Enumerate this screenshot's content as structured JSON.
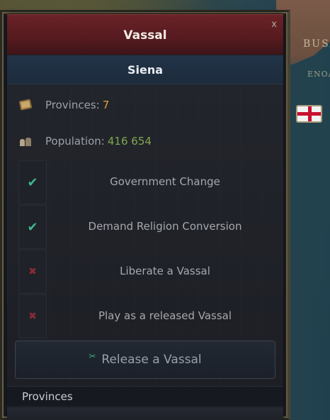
{
  "map": {
    "label_top": "BUSA",
    "label_bottom": "ENOA",
    "flag_icon": "england-flag-icon"
  },
  "window": {
    "title": "Vassal",
    "close_label": "x",
    "country_name": "Siena"
  },
  "stats": {
    "provinces_label": "Provinces:",
    "provinces_value": "7",
    "population_label": "Population:",
    "population_value": "416 654"
  },
  "options": [
    {
      "label": "Government Change",
      "allowed": true
    },
    {
      "label": "Demand Religion Conversion",
      "allowed": true
    },
    {
      "label": "Liberate a Vassal",
      "allowed": false
    },
    {
      "label": "Play as a released Vassal",
      "allowed": false
    }
  ],
  "release_button": {
    "label": "Release a Vassal"
  },
  "provinces_section": {
    "title": "Provinces"
  },
  "colors": {
    "title_bar": "#551a1f",
    "name_bar": "#1d2b3c",
    "provinces_value": "#d9a33a",
    "population_value": "#7fa850",
    "check_yes": "#3fb58a",
    "check_no": "#8a2a36"
  }
}
